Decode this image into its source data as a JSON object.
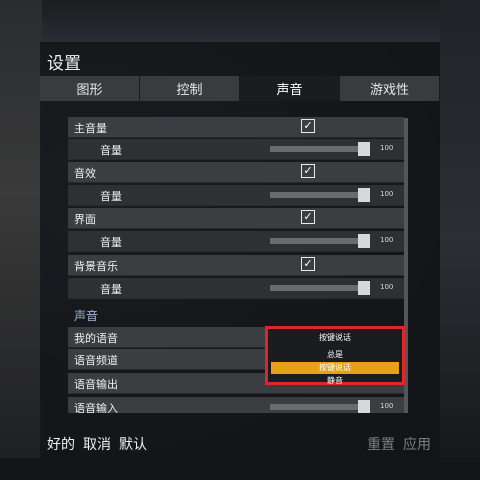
{
  "window": {
    "title": "设置"
  },
  "tabs": [
    {
      "label": "图形"
    },
    {
      "label": "控制"
    },
    {
      "label": "声音"
    },
    {
      "label": "游戏性"
    }
  ],
  "settings": [
    {
      "label": "主音量",
      "checked": true,
      "volume": {
        "label": "音量",
        "value": "100"
      }
    },
    {
      "label": "音效",
      "checked": true,
      "volume": {
        "label": "音量",
        "value": "100"
      }
    },
    {
      "label": "界面",
      "checked": true,
      "volume": {
        "label": "音量",
        "value": "100"
      }
    },
    {
      "label": "背景音乐",
      "checked": true,
      "volume": {
        "label": "音量",
        "value": "100"
      }
    }
  ],
  "voice_section": {
    "title": "声音",
    "rows": [
      {
        "label": "我的语音",
        "value": "按键说话"
      },
      {
        "label": "语音频道"
      },
      {
        "label": "语音输出"
      },
      {
        "label": "语音输入",
        "value": "100"
      }
    ]
  },
  "dropdown": {
    "options": [
      "按键说话",
      "总是",
      "按键说话",
      "静音"
    ],
    "highlighted_index": 2
  },
  "footer": {
    "ok": "好的",
    "cancel": "取消",
    "default": "默认",
    "reset": "重置",
    "apply": "应用"
  },
  "colors": {
    "accent": "#e7a116",
    "highlight_border": "#e0262a",
    "section_title": "#9fb7d6"
  }
}
